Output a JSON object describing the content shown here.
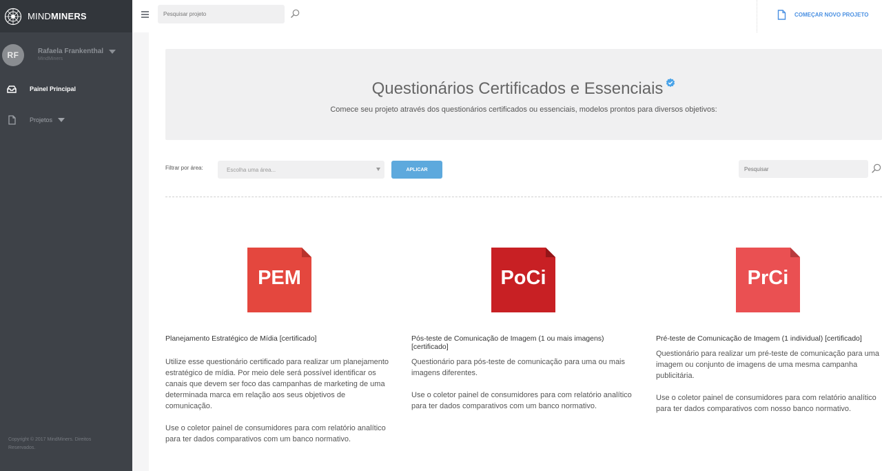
{
  "brand": {
    "name_thin": "MIND",
    "name_bold": "MINERS"
  },
  "user": {
    "initials": "RF",
    "name": "Rafaela Frankenthal",
    "org": "MindMiners"
  },
  "nav": [
    {
      "label": "Painel Principal",
      "icon": "dashboard-icon"
    },
    {
      "label": "Projetos",
      "icon": "document-icon"
    }
  ],
  "footer": {
    "copyright": "Copyright © 2017 MindMiners. Direitos Reservados."
  },
  "header": {
    "search_placeholder": "Pesquisar projeto",
    "new_project_label": "COMEÇAR NOVO PROJETO"
  },
  "hero": {
    "title": "Questionários Certificados e Essenciais",
    "subtitle": "Comece seu projeto através dos questionários certificados ou essenciais, modelos prontos para diversos objetivos:"
  },
  "filter": {
    "label": "Filtrar por área:",
    "select_placeholder": "Escolha uma área...",
    "apply_label": "APLICAR",
    "search_placeholder": "Pesquisar"
  },
  "colors": {
    "sidebar": "#3e4248",
    "accent": "#4a90e2",
    "button": "#5da9dd",
    "pem": "#e4473e",
    "poci": "#c82024",
    "prci": "#ea5052"
  },
  "cards": [
    {
      "abbr": "PEM",
      "title": "Planejamento Estratégico de Mídia [certificado]",
      "p1": "Utilize esse questionário certificado para realizar um planejamento estratégico de mídia. Por meio dele será possível identificar os canais que devem ser foco das campanhas de marketing de uma determinada marca em relação aos seus objetivos de comunicação.",
      "p2": "Use o coletor painel de consumidores para com relatório analítico para ter dados comparativos com um banco normativo."
    },
    {
      "abbr": "PoCi",
      "title": "Pós-teste de Comunicação de Imagem (1 ou mais imagens) [certificado]",
      "p1": "Questionário para pós-teste de comunicação para uma ou mais imagens diferentes.",
      "p2": "Use o coletor painel de consumidores para com relatório analítico para ter dados comparativos com um banco normativo."
    },
    {
      "abbr": "PrCi",
      "title": "Pré-teste de Comunicação de Imagem (1 individual) [certificado]",
      "p1": "Questionário para realizar um pré-teste de comunicação para uma imagem ou conjunto de imagens de uma mesma campanha publicitária.",
      "p2": "Use o coletor painel de consumidores para com relatório analítico para ter dados comparativos com nosso banco normativo."
    }
  ]
}
